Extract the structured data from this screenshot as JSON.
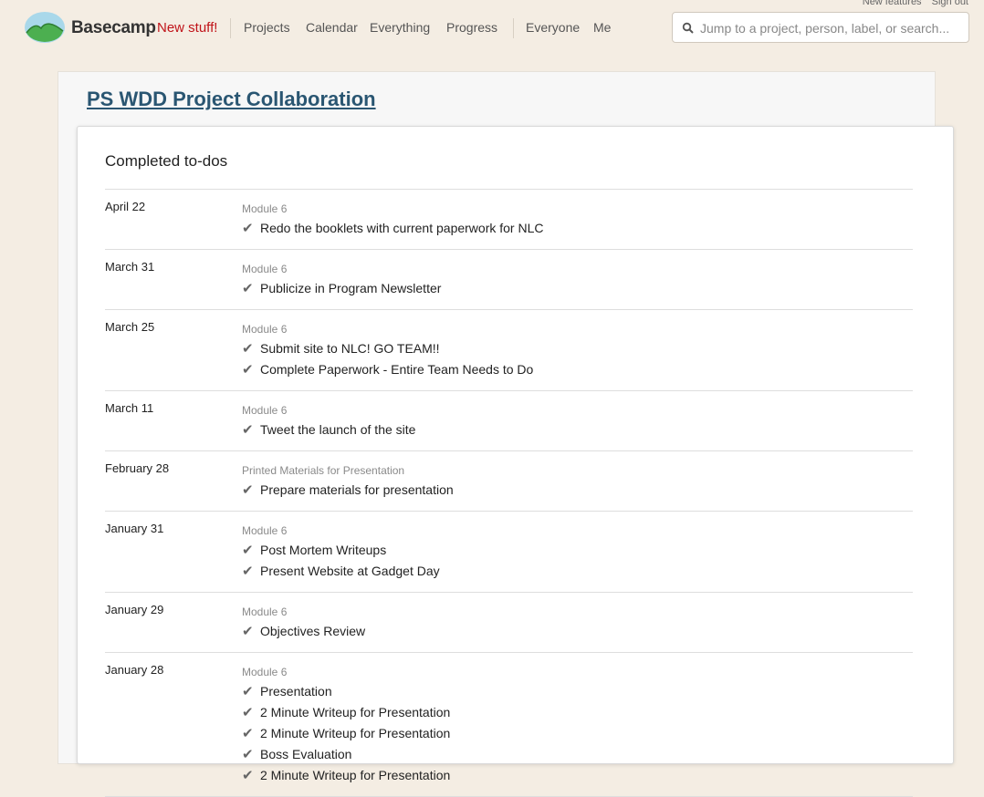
{
  "util": {
    "new_features": "New features",
    "sign_out": "Sign out"
  },
  "brand": {
    "name": "Basecamp",
    "new_stuff": "New stuff!"
  },
  "nav": {
    "projects": "Projects",
    "calendar": "Calendar",
    "everything": "Everything",
    "progress": "Progress",
    "everyone": "Everyone",
    "me": "Me"
  },
  "search": {
    "placeholder": "Jump to a project, person, label, or search..."
  },
  "project": {
    "title": "PS WDD Project Collaboration"
  },
  "section": {
    "title": "Completed to-dos"
  },
  "check_glyph": "✔",
  "groups": [
    {
      "date": "April 22",
      "list": "Module 6",
      "todos": [
        "Redo the booklets with current paperwork for NLC"
      ]
    },
    {
      "date": "March 31",
      "list": "Module 6",
      "todos": [
        "Publicize in Program Newsletter"
      ]
    },
    {
      "date": "March 25",
      "list": "Module 6",
      "todos": [
        "Submit site to NLC! GO TEAM!!",
        "Complete Paperwork - Entire Team Needs to Do"
      ]
    },
    {
      "date": "March 11",
      "list": "Module 6",
      "todos": [
        "Tweet the launch of the site"
      ]
    },
    {
      "date": "February 28",
      "list": "Printed Materials for Presentation",
      "todos": [
        "Prepare materials for presentation"
      ]
    },
    {
      "date": "January 31",
      "list": "Module 6",
      "todos": [
        "Post Mortem Writeups",
        "Present Website at Gadget Day"
      ]
    },
    {
      "date": "January 29",
      "list": "Module 6",
      "todos": [
        "Objectives Review"
      ]
    },
    {
      "date": "January 28",
      "list": "Module 6",
      "todos": [
        "Presentation",
        "2 Minute Writeup for Presentation",
        "2 Minute Writeup for Presentation",
        "Boss Evaluation",
        "2 Minute Writeup for Presentation"
      ]
    }
  ],
  "colors": {
    "background": "#f4ede3",
    "brand_red": "#c0141a",
    "title_link": "#2a5672",
    "logo_green": "#4caf50",
    "logo_sky": "#a9d8ea"
  }
}
